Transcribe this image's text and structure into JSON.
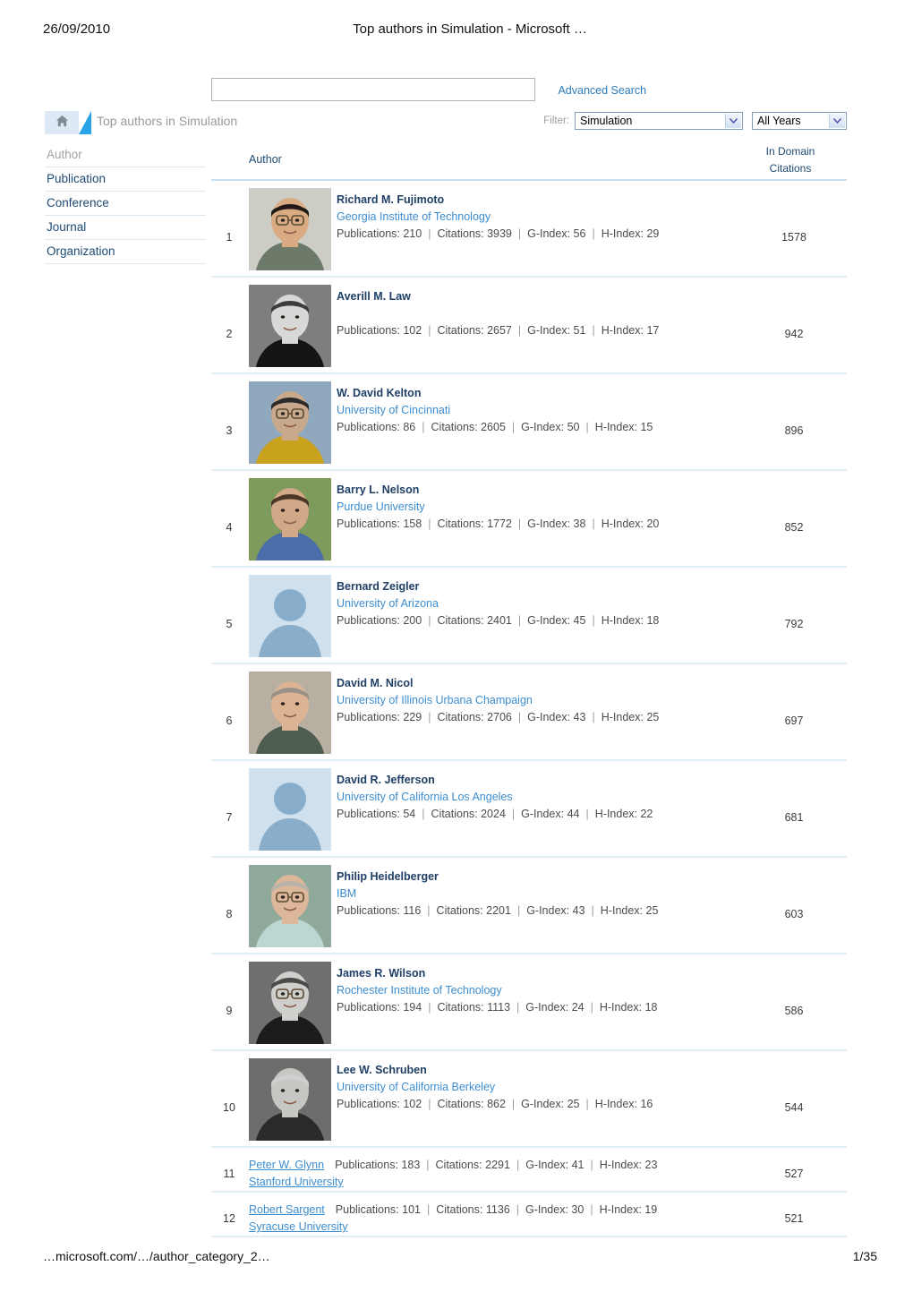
{
  "print": {
    "date": "26/09/2010",
    "title": "Top authors in Simulation - Microsoft …",
    "url": "…microsoft.com/…/author_category_2…",
    "page": "1/35"
  },
  "search": {
    "value": "",
    "placeholder": "",
    "advanced_label": "Advanced Search"
  },
  "breadcrumb": {
    "home_icon": "home-icon",
    "title": "Top authors in Simulation"
  },
  "filter": {
    "label": "Filter:",
    "domain_value": "Simulation",
    "years_value": "All Years",
    "arrow_icon": "chevron-down-icon"
  },
  "leftnav": {
    "items": [
      {
        "label": "Author",
        "active": true
      },
      {
        "label": "Publication",
        "active": false
      },
      {
        "label": "Conference",
        "active": false
      },
      {
        "label": "Journal",
        "active": false
      },
      {
        "label": "Organization",
        "active": false
      }
    ]
  },
  "table": {
    "header": {
      "author": "Author",
      "domain_l1": "In Domain",
      "domain_l2": "Citations"
    },
    "labels": {
      "publications": "Publications:",
      "citations": "Citations:",
      "gindex": "G-Index:",
      "hindex": "H-Index:",
      "sep": "|"
    },
    "rows": [
      {
        "rank": "1",
        "name": "Richard M. Fujimoto",
        "org": "Georgia Institute of Technology",
        "publications": "210",
        "citations": "3939",
        "gindex": "56",
        "hindex": "29",
        "in_domain_citations": "1578",
        "photo": "photo-fujimoto",
        "layout": "tall"
      },
      {
        "rank": "2",
        "name": "Averill M. Law",
        "org": "",
        "publications": "102",
        "citations": "2657",
        "gindex": "51",
        "hindex": "17",
        "in_domain_citations": "942",
        "photo": "photo-law",
        "layout": "tall"
      },
      {
        "rank": "3",
        "name": "W. David Kelton",
        "org": "University of Cincinnati",
        "publications": "86",
        "citations": "2605",
        "gindex": "50",
        "hindex": "15",
        "in_domain_citations": "896",
        "photo": "photo-kelton",
        "layout": "tall"
      },
      {
        "rank": "4",
        "name": "Barry L. Nelson",
        "org": "Purdue University",
        "publications": "158",
        "citations": "1772",
        "gindex": "38",
        "hindex": "20",
        "in_domain_citations": "852",
        "photo": "photo-nelson",
        "layout": "tall"
      },
      {
        "rank": "5",
        "name": "Bernard Zeigler",
        "org": "University of Arizona",
        "publications": "200",
        "citations": "2401",
        "gindex": "45",
        "hindex": "18",
        "in_domain_citations": "792",
        "photo": "avatar-placeholder",
        "layout": "tall"
      },
      {
        "rank": "6",
        "name": "David M. Nicol",
        "org": "University of Illinois Urbana Champaign",
        "publications": "229",
        "citations": "2706",
        "gindex": "43",
        "hindex": "25",
        "in_domain_citations": "697",
        "photo": "photo-nicol",
        "layout": "tall"
      },
      {
        "rank": "7",
        "name": "David R. Jefferson",
        "org": "University of California Los Angeles",
        "publications": "54",
        "citations": "2024",
        "gindex": "44",
        "hindex": "22",
        "in_domain_citations": "681",
        "photo": "avatar-placeholder",
        "layout": "tall"
      },
      {
        "rank": "8",
        "name": "Philip Heidelberger",
        "org": "IBM",
        "publications": "116",
        "citations": "2201",
        "gindex": "43",
        "hindex": "25",
        "in_domain_citations": "603",
        "photo": "photo-heidelberger",
        "layout": "tall"
      },
      {
        "rank": "9",
        "name": "James R. Wilson",
        "org": "Rochester Institute of Technology",
        "publications": "194",
        "citations": "1113",
        "gindex": "24",
        "hindex": "18",
        "in_domain_citations": "586",
        "photo": "photo-wilson",
        "layout": "tall"
      },
      {
        "rank": "10",
        "name": "Lee W. Schruben",
        "org": "University of California Berkeley",
        "publications": "102",
        "citations": "862",
        "gindex": "25",
        "hindex": "16",
        "in_domain_citations": "544",
        "photo": "photo-schruben",
        "layout": "tall"
      },
      {
        "rank": "11",
        "name": "Peter W. Glynn",
        "org": "Stanford University",
        "publications": "183",
        "citations": "2291",
        "gindex": "41",
        "hindex": "23",
        "in_domain_citations": "527",
        "photo": "",
        "layout": "compact"
      },
      {
        "rank": "12",
        "name": "Robert Sargent",
        "org": "Syracuse University",
        "publications": "101",
        "citations": "1136",
        "gindex": "30",
        "hindex": "19",
        "in_domain_citations": "521",
        "photo": "",
        "layout": "compact"
      }
    ]
  },
  "colors": {
    "link_blue": "#3c8dd0",
    "name_navy": "#1f3f66",
    "accent_cyan": "#29a3e8",
    "row_divider": "#e0eef8"
  }
}
